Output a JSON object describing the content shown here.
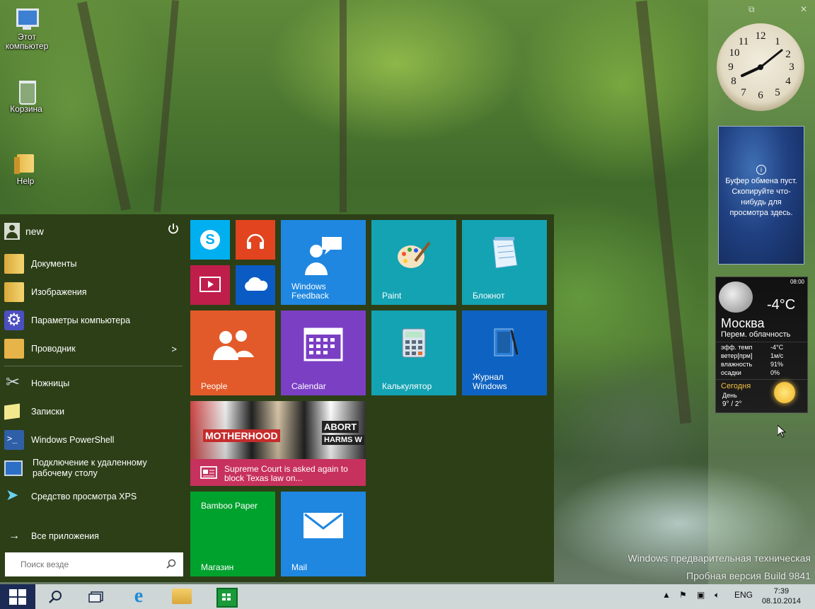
{
  "desktop": {
    "icons": [
      {
        "label": "Этот компьютер",
        "icon": "computer-icon"
      },
      {
        "label": "Корзина",
        "icon": "recycle-bin-icon"
      },
      {
        "label": "Help",
        "icon": "folder-icon"
      }
    ],
    "watermark_line1": "Windows предварительная техническая",
    "watermark_line2": "Пробная версия Build 9841"
  },
  "start_menu": {
    "user_name": "new",
    "items": [
      {
        "label": "Документы",
        "icon": "documents-folder-icon"
      },
      {
        "label": "Изображения",
        "icon": "pictures-folder-icon"
      },
      {
        "label": "Параметры компьютера",
        "icon": "pc-settings-icon"
      },
      {
        "label": "Проводник",
        "icon": "file-explorer-icon"
      },
      {
        "label": "Ножницы",
        "icon": "snipping-tool-icon"
      },
      {
        "label": "Записки",
        "icon": "sticky-notes-icon"
      },
      {
        "label": "Windows PowerShell",
        "icon": "powershell-icon"
      },
      {
        "label": "Подключение к удаленному рабочему столу",
        "icon": "remote-desktop-icon"
      },
      {
        "label": "Средство просмотра XPS",
        "icon": "xps-viewer-icon"
      }
    ],
    "all_apps_label": "Все приложения",
    "search_placeholder": "Поиск везде",
    "tiles": {
      "windows_feedback": "Windows Feedback",
      "paint": "Paint",
      "notepad": "Блокнот",
      "people": "People",
      "calendar": "Calendar",
      "calculator": "Калькулятор",
      "journal": "Журнал Windows",
      "news": "Supreme Court is asked again to block Texas law on...",
      "news_sign1": "MOTHERHOOD",
      "news_sign2": "ABORT",
      "news_sign3": "HARMS W",
      "store_app": "Bamboo Paper",
      "store": "Магазин",
      "mail": "Mail"
    }
  },
  "gadgets": {
    "clock_numbers": [
      "12",
      "1",
      "2",
      "3",
      "4",
      "5",
      "6",
      "7",
      "8",
      "9",
      "10",
      "11"
    ],
    "clipboard_text": "Буфер обмена пуст. Скопируйте что-нибудь для просмотра здесь.",
    "weather": {
      "time": "08:00",
      "temp": "-4°C",
      "city": "Москва",
      "condition": "Перем. облачность",
      "rows": [
        {
          "label": "эфф. темп",
          "value": "-4°C"
        },
        {
          "label": "ветер[прм]",
          "value": "1м/с"
        },
        {
          "label": "влажность",
          "value": "91%"
        },
        {
          "label": "осадки",
          "value": "0%"
        }
      ],
      "today": "Сегодня",
      "day": "День",
      "range": "9° / 2°"
    }
  },
  "taskbar": {
    "lang": "ENG",
    "time": "7:39",
    "date": "08.10.2014"
  }
}
